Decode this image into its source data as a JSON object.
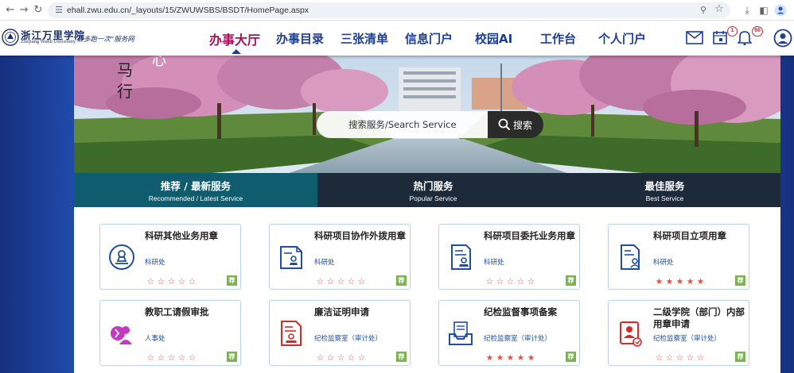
{
  "browser": {
    "url": "ehall.zwu.edu.cn/_layouts/15/ZWUWSBS/BSDT/HomePage.aspx"
  },
  "header": {
    "logo_cn": "浙江万里学院",
    "logo_en": "Zhejiang Wanli University",
    "slogan": "“最多跑一次”服务网",
    "nav": [
      "办事大厅",
      "办事目录",
      "三张清单",
      "信息门户",
      "校园AI",
      "工作台",
      "个人门户"
    ],
    "active_nav": "办事大厅",
    "todo_badge": "1",
    "notify_badge": "66"
  },
  "banner": {
    "calligraphy": [
      "马",
      "行",
      "心"
    ]
  },
  "search": {
    "placeholder": "搜索服务/Search Service",
    "button_label": "搜索"
  },
  "tabs": [
    {
      "cn": "推荐 / 最新服务",
      "en": "Recommended / Latest Service"
    },
    {
      "cn": "热门服务",
      "en": "Popular Service"
    },
    {
      "cn": "最佳服务",
      "en": "Best Service"
    }
  ],
  "cards": [
    {
      "title": "科研其他业务用章",
      "dept": "科研处",
      "rating": 0,
      "icon": "stamp-icon",
      "color": "#1f4ea3"
    },
    {
      "title": "科研项目协作外拨用章",
      "dept": "科研处",
      "rating": 0,
      "icon": "document-stamp-icon",
      "color": "#1f4ea3"
    },
    {
      "title": "科研项目委托业务用章",
      "dept": "科研处",
      "rating": 0,
      "icon": "document-stamp-icon",
      "color": "#1f4ea3"
    },
    {
      "title": "科研项目立项用章",
      "dept": "科研处",
      "rating": 5,
      "icon": "document-person-icon",
      "color": "#1f4ea3"
    },
    {
      "title": "教职工请假审批",
      "dept": "人事处",
      "rating": 0,
      "icon": "leave-icon",
      "color": "#c13ac1"
    },
    {
      "title": "廉洁证明申请",
      "dept": "纪检监察室（审计处）",
      "rating": 0,
      "icon": "certificate-stamp-icon",
      "color": "#d32a2a"
    },
    {
      "title": "纪检监督事项备案",
      "dept": "纪检监察室（审计处）",
      "rating": 5,
      "icon": "inbox-document-icon",
      "color": "#1f4ea3"
    },
    {
      "title": "二级学院（部门）内部用章申请",
      "dept": "纪检监察室（审计处）",
      "rating": 0,
      "icon": "badge-person-icon",
      "color": "#d32a2a"
    }
  ],
  "rec_label": "荐",
  "colors": {
    "nav_blue": "#1c3e94",
    "nav_active": "#a4125d",
    "tab_active": "#0f5c6e",
    "tab_inactive": "#1d2a3a",
    "star_red": "#e74c3c",
    "rec_green": "#79b64a"
  }
}
